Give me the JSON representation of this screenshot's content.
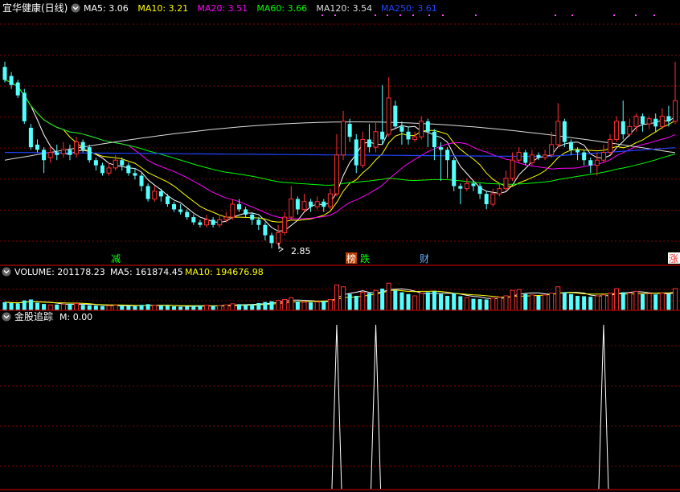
{
  "window": {
    "title": "宜华健康(日线)"
  },
  "price_panel": {
    "ma_legend": [
      {
        "label": "MA5: 3.06",
        "color": "#ffffff"
      },
      {
        "label": "MA10: 3.21",
        "color": "#ffff00"
      },
      {
        "label": "MA20: 3.51",
        "color": "#ff00ff"
      },
      {
        "label": "MA60: 3.66",
        "color": "#00ff00"
      },
      {
        "label": "MA120: 3.54",
        "color": "#dddddd"
      },
      {
        "label": "MA250: 3.61",
        "color": "#2244ff"
      }
    ],
    "low_marker": "2.85",
    "event_markers": [
      {
        "text": "减",
        "color": "#00ff00",
        "bg": "none"
      },
      {
        "text": "榜",
        "color": "#ffffff",
        "bg": "#c04000"
      },
      {
        "text": "跌",
        "color": "#00ff00",
        "bg": "none"
      },
      {
        "text": "财",
        "color": "#66aaff",
        "bg": "none"
      },
      {
        "text": "涨",
        "color": "#ff4040",
        "bg": "#ffffff"
      }
    ]
  },
  "volume_panel": {
    "label": "VOLUME: 201178.23",
    "ma_legend": [
      {
        "label": "MA5: 161874.45",
        "color": "#ffffff"
      },
      {
        "label": "MA10: 194676.98",
        "color": "#ffff00"
      }
    ]
  },
  "indicator_panel": {
    "name": "金股追踪",
    "value_label": "M: 0.00"
  },
  "colors": {
    "up": "#ff3030",
    "down": "#54ffff",
    "grid": "#8a0000",
    "border": "#b00000",
    "signal": "#ffffff"
  },
  "chart_data": {
    "type": "candlestick",
    "title": "宜华健康(日线)",
    "ylim": [
      2.6,
      4.4
    ],
    "low_annotation": 2.85,
    "candles": [
      [
        4.02,
        3.92,
        4.06,
        3.9
      ],
      [
        3.95,
        3.88,
        3.98,
        3.85
      ],
      [
        3.9,
        3.8,
        3.92,
        3.78
      ],
      [
        3.82,
        3.6,
        3.85,
        3.58
      ],
      [
        3.55,
        3.4,
        3.58,
        3.38
      ],
      [
        3.42,
        3.38,
        3.46,
        3.36
      ],
      [
        3.38,
        3.3,
        3.4,
        3.2
      ],
      [
        3.32,
        3.36,
        3.4,
        3.28
      ],
      [
        3.36,
        3.34,
        3.42,
        3.3
      ],
      [
        3.35,
        3.38,
        3.44,
        3.32
      ],
      [
        3.38,
        3.34,
        3.42,
        3.3
      ],
      [
        3.35,
        3.44,
        3.48,
        3.32
      ],
      [
        3.44,
        3.38,
        3.46,
        3.36
      ],
      [
        3.4,
        3.3,
        3.42,
        3.28
      ],
      [
        3.3,
        3.26,
        3.32,
        3.22
      ],
      [
        3.26,
        3.2,
        3.28,
        3.18
      ],
      [
        3.2,
        3.24,
        3.28,
        3.18
      ],
      [
        3.24,
        3.3,
        3.34,
        3.22
      ],
      [
        3.3,
        3.26,
        3.32,
        3.22
      ],
      [
        3.26,
        3.2,
        3.28,
        3.18
      ],
      [
        3.2,
        3.18,
        3.24,
        3.15
      ],
      [
        3.18,
        3.1,
        3.2,
        3.06
      ],
      [
        3.1,
        3.0,
        3.12,
        2.98
      ],
      [
        3.0,
        3.06,
        3.1,
        2.98
      ],
      [
        3.06,
        3.02,
        3.08,
        2.98
      ],
      [
        3.02,
        2.96,
        3.04,
        2.94
      ],
      [
        2.96,
        2.92,
        2.98,
        2.9
      ],
      [
        2.92,
        2.9,
        2.96,
        2.88
      ],
      [
        2.9,
        2.86,
        2.92,
        2.84
      ],
      [
        2.86,
        2.82,
        2.88,
        2.8
      ],
      [
        2.82,
        2.8,
        2.84,
        2.78
      ],
      [
        2.8,
        2.84,
        2.88,
        2.78
      ],
      [
        2.84,
        2.8,
        2.86,
        2.78
      ],
      [
        2.8,
        2.84,
        2.88,
        2.78
      ],
      [
        2.84,
        2.86,
        2.9,
        2.82
      ],
      [
        2.86,
        2.96,
        3.0,
        2.84
      ],
      [
        2.96,
        2.92,
        3.0,
        2.9
      ],
      [
        2.92,
        2.88,
        2.94,
        2.86
      ],
      [
        2.88,
        2.84,
        2.9,
        2.8
      ],
      [
        2.84,
        2.8,
        2.86,
        2.76
      ],
      [
        2.8,
        2.72,
        2.82,
        2.68
      ],
      [
        2.72,
        2.66,
        2.74,
        2.62
      ],
      [
        2.66,
        2.74,
        2.8,
        2.64
      ],
      [
        2.74,
        2.86,
        2.9,
        2.72
      ],
      [
        2.86,
        3.0,
        3.1,
        2.84
      ],
      [
        3.0,
        2.92,
        3.02,
        2.88
      ],
      [
        2.92,
        2.98,
        3.04,
        2.9
      ],
      [
        2.98,
        2.94,
        3.0,
        2.9
      ],
      [
        2.94,
        2.98,
        3.02,
        2.92
      ],
      [
        2.98,
        2.94,
        3.0,
        2.9
      ],
      [
        2.94,
        3.04,
        3.08,
        2.92
      ],
      [
        3.04,
        3.34,
        3.5,
        3.02
      ],
      [
        3.34,
        3.6,
        3.68,
        3.3
      ],
      [
        3.58,
        3.48,
        3.62,
        3.44
      ],
      [
        3.46,
        3.26,
        3.5,
        3.2
      ],
      [
        3.26,
        3.46,
        3.52,
        3.24
      ],
      [
        3.46,
        3.4,
        3.58,
        3.36
      ],
      [
        3.4,
        3.52,
        3.6,
        3.36
      ],
      [
        3.52,
        3.46,
        3.88,
        3.42
      ],
      [
        3.5,
        3.78,
        3.94,
        3.48
      ],
      [
        3.72,
        3.56,
        3.76,
        3.54
      ],
      [
        3.56,
        3.52,
        3.6,
        3.42
      ],
      [
        3.52,
        3.46,
        3.56,
        3.42
      ],
      [
        3.46,
        3.48,
        3.52,
        3.44
      ],
      [
        3.48,
        3.6,
        3.64,
        3.46
      ],
      [
        3.6,
        3.52,
        3.62,
        3.4
      ],
      [
        3.52,
        3.4,
        3.54,
        3.3
      ],
      [
        3.4,
        3.38,
        3.44,
        3.14
      ],
      [
        3.38,
        3.3,
        3.4,
        3.16
      ],
      [
        3.3,
        3.1,
        3.32,
        3.06
      ],
      [
        3.1,
        3.08,
        3.12,
        2.96
      ],
      [
        3.08,
        3.12,
        3.16,
        3.06
      ],
      [
        3.12,
        3.1,
        3.14,
        3.06
      ],
      [
        3.1,
        3.04,
        3.12,
        3.0
      ],
      [
        3.04,
        2.96,
        3.06,
        2.92
      ],
      [
        2.96,
        3.04,
        3.08,
        2.94
      ],
      [
        3.04,
        3.08,
        3.12,
        3.02
      ],
      [
        3.08,
        3.16,
        3.22,
        3.06
      ],
      [
        3.16,
        3.3,
        3.36,
        3.14
      ],
      [
        3.3,
        3.36,
        3.4,
        3.28
      ],
      [
        3.36,
        3.28,
        3.38,
        3.26
      ],
      [
        3.28,
        3.34,
        3.38,
        3.26
      ],
      [
        3.34,
        3.32,
        3.36,
        3.3
      ],
      [
        3.32,
        3.34,
        3.38,
        3.3
      ],
      [
        3.34,
        3.42,
        3.52,
        3.32
      ],
      [
        3.42,
        3.6,
        3.74,
        3.4
      ],
      [
        3.6,
        3.44,
        3.62,
        3.4
      ],
      [
        3.44,
        3.38,
        3.46,
        3.34
      ],
      [
        3.38,
        3.36,
        3.4,
        3.3
      ],
      [
        3.36,
        3.3,
        3.38,
        3.26
      ],
      [
        3.3,
        3.26,
        3.32,
        3.2
      ],
      [
        3.26,
        3.3,
        3.36,
        3.18
      ],
      [
        3.3,
        3.36,
        3.42,
        3.28
      ],
      [
        3.36,
        3.46,
        3.5,
        3.34
      ],
      [
        3.46,
        3.6,
        3.64,
        3.44
      ],
      [
        3.6,
        3.5,
        3.76,
        3.46
      ],
      [
        3.5,
        3.56,
        3.62,
        3.48
      ],
      [
        3.56,
        3.64,
        3.66,
        3.52
      ],
      [
        3.64,
        3.58,
        3.66,
        3.52
      ],
      [
        3.58,
        3.62,
        3.64,
        3.54
      ],
      [
        3.62,
        3.56,
        3.66,
        3.52
      ],
      [
        3.56,
        3.64,
        3.7,
        3.54
      ],
      [
        3.64,
        3.6,
        3.72,
        3.56
      ],
      [
        3.6,
        3.76,
        4.06,
        3.58
      ]
    ],
    "volume": [
      45,
      40,
      38,
      55,
      60,
      42,
      35,
      30,
      32,
      34,
      36,
      38,
      30,
      28,
      26,
      24,
      25,
      28,
      26,
      24,
      22,
      30,
      34,
      28,
      26,
      24,
      22,
      20,
      22,
      24,
      26,
      28,
      24,
      26,
      30,
      36,
      34,
      30,
      32,
      40,
      46,
      50,
      55,
      60,
      70,
      48,
      45,
      44,
      46,
      50,
      60,
      140,
      130,
      90,
      80,
      100,
      95,
      110,
      120,
      150,
      110,
      100,
      90,
      80,
      95,
      100,
      105,
      90,
      80,
      95,
      78,
      70,
      64,
      62,
      60,
      68,
      72,
      80,
      110,
      115,
      90,
      85,
      80,
      85,
      95,
      130,
      100,
      90,
      80,
      78,
      75,
      80,
      85,
      95,
      120,
      100,
      95,
      105,
      90,
      92,
      88,
      95,
      90,
      120
    ],
    "volume_max": 160,
    "indicator_signals": [
      {
        "index": 51,
        "value": 1
      },
      {
        "index": 57,
        "value": 1
      },
      {
        "index": 92,
        "value": 1
      }
    ]
  }
}
